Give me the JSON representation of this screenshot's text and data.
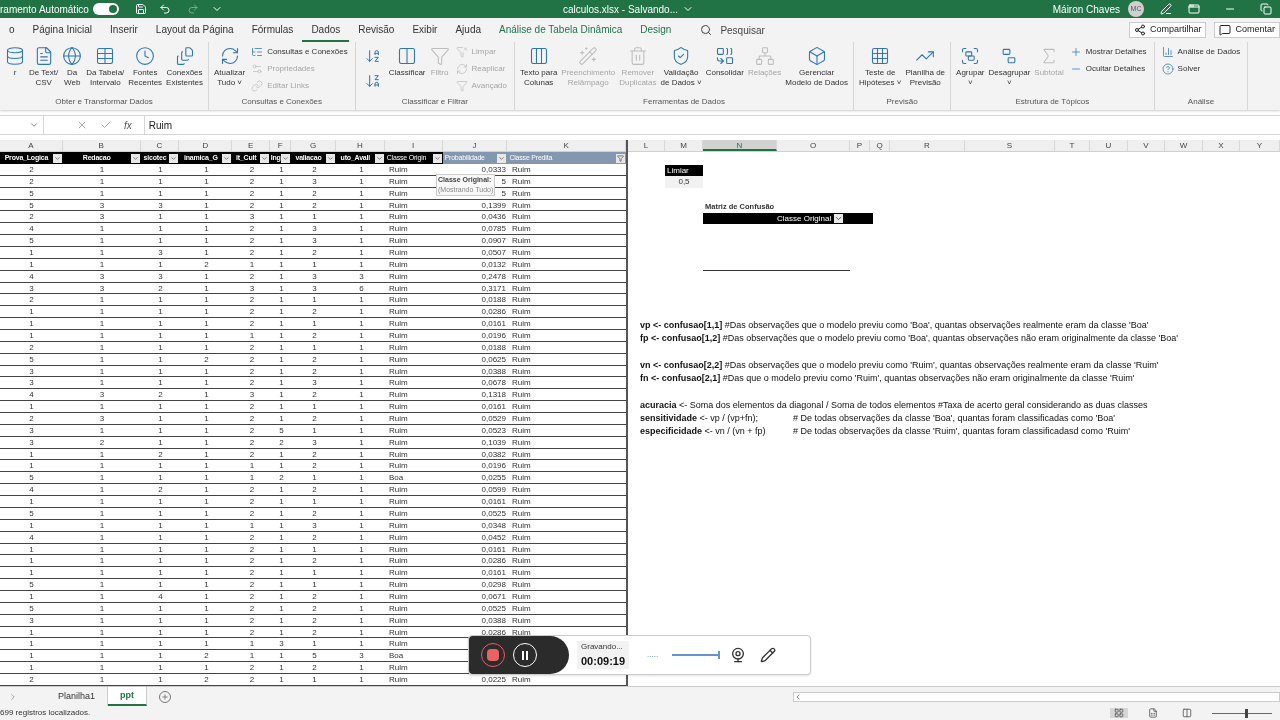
{
  "title_bar": {
    "autosave_label": "ramento Automático",
    "autosave_on": true,
    "title": "calculos.xlsx - Salvando...",
    "user": "Máiron Chaves",
    "initials": "MC"
  },
  "menu_tabs": [
    {
      "label": "o",
      "selected": false
    },
    {
      "label": "Página Inicial",
      "selected": false
    },
    {
      "label": "Inserir",
      "selected": false
    },
    {
      "label": "Layout da Página",
      "selected": false
    },
    {
      "label": "Fórmulas",
      "selected": false
    },
    {
      "label": "Dados",
      "selected": true
    },
    {
      "label": "Revisão",
      "selected": false
    },
    {
      "label": "Exibir",
      "selected": false
    },
    {
      "label": "Ajuda",
      "selected": false
    },
    {
      "label": "Análise de Tabela Dinâmica",
      "selected": false,
      "kind": "context"
    },
    {
      "label": "Design",
      "selected": false,
      "kind": "context"
    }
  ],
  "search": {
    "placeholder": "Pesquisar"
  },
  "share_buttons": [
    "Compartilhar",
    "Comentar"
  ],
  "ribbon_groups": [
    {
      "title": "Obter e Transformar Dados",
      "items": [
        {
          "kind": "large",
          "label": "r",
          "disabled": false
        },
        {
          "kind": "large",
          "label": "De Text/\nCSV",
          "disabled": false
        },
        {
          "kind": "large",
          "label": "Da\nWeb",
          "disabled": false
        },
        {
          "kind": "large",
          "label": "Da Tabela/\nIntervalo",
          "disabled": false
        },
        {
          "kind": "large",
          "label": "Fontes\nRecentes",
          "disabled": false
        },
        {
          "kind": "large",
          "label": "Conexões\nExistentes",
          "disabled": false
        }
      ]
    },
    {
      "title": "Consultas e Conexões",
      "items": [
        {
          "kind": "large",
          "label": "Atualizar\nTudo ˅",
          "disabled": false
        },
        {
          "kind": "stack",
          "items": [
            {
              "kind": "small",
              "label": "Consultas e Conexões",
              "disabled": false
            },
            {
              "kind": "small",
              "label": "Propriedades",
              "disabled": true
            },
            {
              "kind": "small",
              "label": "Editar Links",
              "disabled": true
            }
          ]
        }
      ]
    },
    {
      "title": "Classificar e Filtrar",
      "items": [
        {
          "kind": "stack",
          "items": [
            {
              "kind": "icon",
              "disabled": false
            },
            {
              "kind": "icon",
              "disabled": false
            }
          ]
        },
        {
          "kind": "large",
          "label": "Classificar",
          "disabled": false
        },
        {
          "kind": "large",
          "label": "Filtro",
          "disabled": true
        },
        {
          "kind": "stack",
          "items": [
            {
              "kind": "small",
              "label": "Limpar",
              "disabled": true
            },
            {
              "kind": "small",
              "label": "Reaplicar",
              "disabled": true
            },
            {
              "kind": "small",
              "label": "Avançado",
              "disabled": true
            }
          ]
        }
      ]
    },
    {
      "title": "Ferramentas de Dados",
      "items": [
        {
          "kind": "large",
          "label": "Texto para\nColunas",
          "disabled": false
        },
        {
          "kind": "large",
          "label": "Preenchimento\nRelâmpago",
          "disabled": true
        },
        {
          "kind": "large",
          "label": "Remover\nDuplicatas",
          "disabled": true
        },
        {
          "kind": "large",
          "label": "Validação\nde Dados ˅",
          "disabled": false
        },
        {
          "kind": "large",
          "label": "Consolidar",
          "disabled": false
        },
        {
          "kind": "large",
          "label": "Relações",
          "disabled": true
        },
        {
          "kind": "large",
          "label": "Gerenciar\nModelo de Dados",
          "disabled": false
        }
      ]
    },
    {
      "title": "Previsão",
      "items": [
        {
          "kind": "large",
          "label": "Teste de\nHipóteses ˅",
          "disabled": false
        },
        {
          "kind": "large",
          "label": "Planilha de\nPrevisão",
          "disabled": false
        }
      ]
    },
    {
      "title": "Estrutura de Tópicos",
      "items": [
        {
          "kind": "large",
          "label": "Agrupar\n˅",
          "disabled": false
        },
        {
          "kind": "large",
          "label": "Desagrupar\n˅",
          "disabled": false
        },
        {
          "kind": "large",
          "label": "Subtotal",
          "disabled": true
        },
        {
          "kind": "stack",
          "items": [
            {
              "kind": "small",
              "label": "Mostrar Detalhes",
              "disabled": false
            },
            {
              "kind": "small",
              "label": "Ocultar Detalhes",
              "disabled": false
            }
          ]
        }
      ]
    },
    {
      "title": "Análise",
      "items": [
        {
          "kind": "stack",
          "items": [
            {
              "kind": "small",
              "label": "Análise de Dados",
              "disabled": false
            },
            {
              "kind": "small",
              "label": "Solver",
              "disabled": false
            }
          ]
        }
      ]
    }
  ],
  "formula_bar": {
    "function_label": "fx",
    "value": "Ruim"
  },
  "left_columns": [
    {
      "letter": "A",
      "header": "Prova_Logica",
      "kind": "plain",
      "filtered": false
    },
    {
      "letter": "B",
      "header": "Redacao",
      "kind": "plain",
      "filtered": false
    },
    {
      "letter": "C",
      "header": "sicotec",
      "kind": "plain",
      "filtered": false
    },
    {
      "letter": "D",
      "header": "inamica_G",
      "kind": "plain",
      "filtered": false
    },
    {
      "letter": "E",
      "header": "it_Cult",
      "kind": "plain",
      "filtered": false
    },
    {
      "letter": "F",
      "header": "Ing",
      "kind": "plain",
      "filtered": false
    },
    {
      "letter": "G",
      "header": "valiacao",
      "kind": "plain",
      "filtered": false
    },
    {
      "letter": "H",
      "header": "uto_Avali",
      "kind": "plain",
      "filtered": false
    },
    {
      "letter": "I",
      "header": "Classe Origin",
      "kind": "plain",
      "filtered": false
    },
    {
      "letter": "J",
      "header": "Probabilidade",
      "kind": "computed",
      "filtered": false
    },
    {
      "letter": "K",
      "header": "Classe Predita",
      "kind": "computed",
      "filtered": true
    }
  ],
  "rows": [
    [
      "2",
      "1",
      "1",
      "1",
      "2",
      "1",
      "2",
      "1",
      "Ruim",
      "0,0333",
      "Ruim"
    ],
    [
      "2",
      "1",
      "1",
      "1",
      "2",
      "1",
      "3",
      "1",
      "Ruim",
      "5",
      "Ruim"
    ],
    [
      "5",
      "1",
      "1",
      "1",
      "2",
      "1",
      "2",
      "1",
      "Ruim",
      "5",
      "Ruim"
    ],
    [
      "5",
      "3",
      "3",
      "1",
      "2",
      "1",
      "2",
      "1",
      "Ruim",
      "0,1399",
      "Ruim"
    ],
    [
      "2",
      "3",
      "1",
      "1",
      "3",
      "1",
      "1",
      "1",
      "Ruim",
      "0,0436",
      "Ruim"
    ],
    [
      "4",
      "1",
      "1",
      "1",
      "2",
      "1",
      "3",
      "1",
      "Ruim",
      "0,0785",
      "Ruim"
    ],
    [
      "5",
      "1",
      "1",
      "1",
      "2",
      "1",
      "3",
      "1",
      "Ruim",
      "0,0907",
      "Ruim"
    ],
    [
      "1",
      "1",
      "3",
      "1",
      "2",
      "1",
      "2",
      "1",
      "Ruim",
      "0,0507",
      "Ruim"
    ],
    [
      "1",
      "1",
      "1",
      "2",
      "1",
      "1",
      "1",
      "1",
      "Ruim",
      "0,0132",
      "Ruim"
    ],
    [
      "4",
      "3",
      "3",
      "1",
      "2",
      "1",
      "3",
      "3",
      "Ruim",
      "0,2478",
      "Ruim"
    ],
    [
      "3",
      "3",
      "2",
      "1",
      "3",
      "1",
      "3",
      "6",
      "Ruim",
      "0,3171",
      "Ruim"
    ],
    [
      "2",
      "1",
      "1",
      "1",
      "2",
      "1",
      "1",
      "1",
      "Ruim",
      "0,0188",
      "Ruim"
    ],
    [
      "1",
      "1",
      "1",
      "1",
      "2",
      "1",
      "2",
      "1",
      "Ruim",
      "0,0286",
      "Ruim"
    ],
    [
      "1",
      "1",
      "1",
      "1",
      "2",
      "1",
      "1",
      "1",
      "Ruim",
      "0,0161",
      "Ruim"
    ],
    [
      "1",
      "1",
      "1",
      "1",
      "1",
      "1",
      "2",
      "1",
      "Ruim",
      "0,0196",
      "Ruim"
    ],
    [
      "2",
      "1",
      "1",
      "1",
      "2",
      "1",
      "1",
      "1",
      "Ruim",
      "0,0188",
      "Ruim"
    ],
    [
      "5",
      "1",
      "1",
      "2",
      "2",
      "1",
      "2",
      "1",
      "Ruim",
      "0,0625",
      "Ruim"
    ],
    [
      "3",
      "1",
      "1",
      "1",
      "2",
      "1",
      "2",
      "1",
      "Ruim",
      "0,0388",
      "Ruim"
    ],
    [
      "3",
      "1",
      "1",
      "1",
      "2",
      "1",
      "3",
      "1",
      "Ruim",
      "0,0678",
      "Ruim"
    ],
    [
      "4",
      "3",
      "2",
      "1",
      "3",
      "1",
      "2",
      "1",
      "Ruim",
      "0,1318",
      "Ruim"
    ],
    [
      "1",
      "1",
      "1",
      "1",
      "2",
      "1",
      "1",
      "1",
      "Ruim",
      "0,0161",
      "Ruim"
    ],
    [
      "2",
      "3",
      "1",
      "1",
      "2",
      "1",
      "2",
      "1",
      "Ruim",
      "0,0529",
      "Ruim"
    ],
    [
      "3",
      "1",
      "1",
      "1",
      "2",
      "5",
      "1",
      "1",
      "Ruim",
      "0,0523",
      "Ruim"
    ],
    [
      "3",
      "2",
      "1",
      "1",
      "2",
      "2",
      "3",
      "1",
      "Ruim",
      "0,1039",
      "Ruim"
    ],
    [
      "1",
      "1",
      "2",
      "1",
      "2",
      "1",
      "2",
      "1",
      "Ruim",
      "0,0382",
      "Ruim"
    ],
    [
      "1",
      "1",
      "1",
      "1",
      "1",
      "1",
      "2",
      "1",
      "Ruim",
      "0,0196",
      "Ruim"
    ],
    [
      "5",
      "1",
      "1",
      "1",
      "1",
      "2",
      "1",
      "1",
      "Boa",
      "0,0255",
      "Ruim"
    ],
    [
      "4",
      "1",
      "2",
      "1",
      "2",
      "1",
      "2",
      "1",
      "Ruim",
      "0,0599",
      "Ruim"
    ],
    [
      "1",
      "1",
      "1",
      "1",
      "2",
      "1",
      "1",
      "1",
      "Ruim",
      "0,0161",
      "Ruim"
    ],
    [
      "5",
      "1",
      "1",
      "1",
      "2",
      "1",
      "2",
      "1",
      "Ruim",
      "0,0525",
      "Ruim"
    ],
    [
      "1",
      "1",
      "1",
      "1",
      "1",
      "1",
      "3",
      "1",
      "Ruim",
      "0,0348",
      "Ruim"
    ],
    [
      "4",
      "1",
      "1",
      "1",
      "2",
      "1",
      "2",
      "1",
      "Ruim",
      "0,0452",
      "Ruim"
    ],
    [
      "1",
      "1",
      "1",
      "1",
      "2",
      "1",
      "1",
      "1",
      "Ruim",
      "0,0161",
      "Ruim"
    ],
    [
      "1",
      "1",
      "1",
      "1",
      "2",
      "1",
      "2",
      "1",
      "Ruim",
      "0,0286",
      "Ruim"
    ],
    [
      "1",
      "1",
      "1",
      "1",
      "2",
      "1",
      "1",
      "1",
      "Ruim",
      "0,0161",
      "Ruim"
    ],
    [
      "5",
      "1",
      "1",
      "1",
      "2",
      "1",
      "1",
      "1",
      "Ruim",
      "0,0298",
      "Ruim"
    ],
    [
      "1",
      "1",
      "4",
      "1",
      "2",
      "1",
      "2",
      "1",
      "Ruim",
      "0,0671",
      "Ruim"
    ],
    [
      "5",
      "1",
      "1",
      "1",
      "2",
      "1",
      "2",
      "1",
      "Ruim",
      "0,0525",
      "Ruim"
    ],
    [
      "3",
      "1",
      "1",
      "1",
      "2",
      "1",
      "2",
      "1",
      "Ruim",
      "0,0388",
      "Ruim"
    ],
    [
      "1",
      "1",
      "1",
      "1",
      "2",
      "1",
      "2",
      "1",
      "Ruim",
      "0,0286",
      "Ruim"
    ],
    [
      "1",
      "1",
      "1",
      "1",
      "1",
      "3",
      "1",
      "1",
      "Ruim",
      null,
      null
    ],
    [
      "1",
      "1",
      "1",
      "2",
      "1",
      "1",
      "5",
      "3",
      "Boa",
      null,
      null
    ],
    [
      "1",
      "1",
      "1",
      "1",
      "2",
      "1",
      "2",
      "1",
      "Ruim",
      null,
      null
    ],
    [
      "2",
      "1",
      "1",
      "2",
      "2",
      "1",
      "1",
      "1",
      "Ruim",
      "0,0225",
      "Ruim"
    ]
  ],
  "filter_tooltip": {
    "title": "Classe Original:",
    "detail": "(Mostrando Tudo)"
  },
  "right_columns": [
    {
      "letter": "L",
      "selected": false
    },
    {
      "letter": "M",
      "selected": false
    },
    {
      "letter": "N",
      "selected": true
    },
    {
      "letter": "O",
      "selected": false
    },
    {
      "letter": "P",
      "selected": false
    },
    {
      "letter": "Q",
      "selected": false
    },
    {
      "letter": "R",
      "selected": false
    },
    {
      "letter": "S",
      "selected": false
    },
    {
      "letter": "T",
      "selected": false
    },
    {
      "letter": "U",
      "selected": false
    },
    {
      "letter": "V",
      "selected": false
    },
    {
      "letter": "W",
      "selected": false
    },
    {
      "letter": "X",
      "selected": false
    },
    {
      "letter": "Y",
      "selected": false
    }
  ],
  "threshold": {
    "label": "Limiar",
    "value": "0,5"
  },
  "confusion_matrix": {
    "title": "Matriz de Confusão",
    "header": "Classe Original"
  },
  "notes": [
    [
      {
        "text": "**vp <- confusao[1,1]**  #Das observações que o modelo previu como 'Boa', quantas observações realmente eram da classe 'Boa'"
      },
      {
        "text": "**fp <- confusao[1,2]**  #Das observações que o modelo previu como 'Boa', quantas observações não eram originalmente da classe 'Boa'"
      }
    ],
    [
      {
        "text": "**vn <- confusao[2,2]** #Das observações que o modelo previu como 'Ruim', quantas observações realmente eram da classe 'Ruim'"
      },
      {
        "text": "**fn <- confusao[2,1]** #Das que o modelo previu como 'Ruim', quantas observações não eram originalmente da classe 'Ruim'"
      }
    ],
    [
      {
        "text": "**acuracia** <- Soma dos elementos da diagonal / Soma de todos elementos #Taxa de acerto geral considerando as duas classes"
      },
      {
        "text": "**sensitividade** <- vp / (vp+fn);",
        "comment": "# De todas observações da classe 'Boa', quantas foram classificadas como 'Boa'"
      },
      {
        "text": "**especificidade** <- vn / (vn + fp)",
        "comment": "# De todas observações da classe 'Ruim', quantas foram classificadasd como 'Ruim'"
      }
    ]
  ],
  "recorder": {
    "status": "Gravando...",
    "time": "00:09:19",
    "dots": "....."
  },
  "sheet_tabs": [
    {
      "label": "Planilha1",
      "selected": false
    },
    {
      "label": "ppt",
      "selected": true
    }
  ],
  "status_bar": {
    "text": "699 registros localizados.",
    "views": [
      {
        "selected": true
      },
      {
        "selected": false
      },
      {
        "selected": false
      }
    ],
    "zoom": {
      "level": 0.55
    }
  }
}
